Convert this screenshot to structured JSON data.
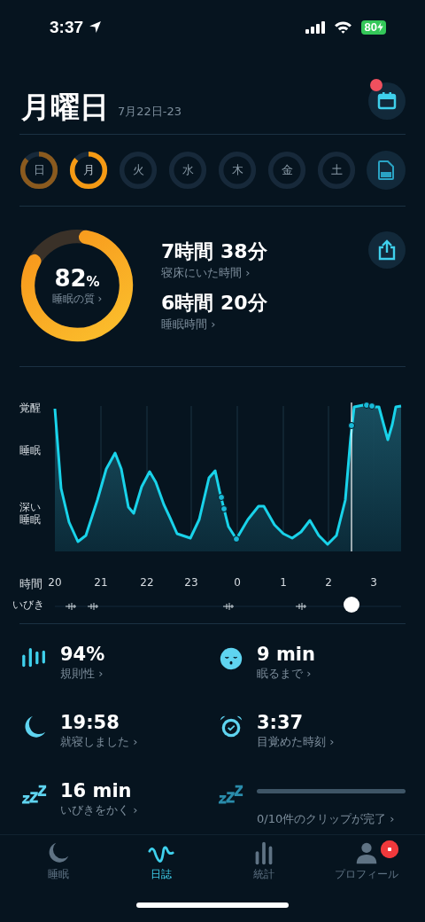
{
  "status_bar": {
    "time": "3:37",
    "battery": "80"
  },
  "header": {
    "title": "月曜日",
    "date_range": "7月22日-23",
    "calendar_badge": true
  },
  "days": [
    {
      "label": "日",
      "selected": false,
      "recorded": true
    },
    {
      "label": "月",
      "selected": true,
      "recorded": true
    },
    {
      "label": "火",
      "selected": false,
      "recorded": false
    },
    {
      "label": "水",
      "selected": false,
      "recorded": false
    },
    {
      "label": "木",
      "selected": false,
      "recorded": false
    },
    {
      "label": "金",
      "selected": false,
      "recorded": false
    },
    {
      "label": "土",
      "selected": false,
      "recorded": false
    }
  ],
  "summary": {
    "quality": {
      "value": "82",
      "unit": "%",
      "label": "睡眠の質 ›"
    },
    "metrics": [
      {
        "value": "7時間 38分",
        "label": "寝床にいた時間 ›"
      },
      {
        "value": "6時間 20分",
        "label": "睡眠時間 ›"
      }
    ]
  },
  "chart": {
    "y_labels": [
      "覚醒",
      "睡眠",
      "深い睡眠"
    ],
    "x_label": "時間",
    "x_ticks": [
      "20",
      "21",
      "22",
      "23",
      "0",
      "1",
      "2",
      "3"
    ],
    "snore_label": "いびき"
  },
  "stats": [
    {
      "kind": "stat",
      "value": "94%",
      "label": "規則性 ›"
    },
    {
      "kind": "stat",
      "value": "9 min",
      "label": "眠るまで ›"
    },
    {
      "kind": "stat",
      "value": "19:58",
      "label": "就寝しました ›"
    },
    {
      "kind": "stat",
      "value": "3:37",
      "label": "目覚めた時刻 ›"
    },
    {
      "kind": "stat",
      "value": "16 min",
      "label": "いびきをかく ›"
    },
    {
      "kind": "progress",
      "level": 0,
      "label": "0/10件のクリップが完了 ›"
    }
  ],
  "tab_bar": [
    {
      "label": "睡眠",
      "selected": false,
      "badge": false
    },
    {
      "label": "日誌",
      "selected": true,
      "badge": false
    },
    {
      "label": "統計",
      "selected": false,
      "badge": false
    },
    {
      "label": "プロフィール",
      "selected": false,
      "badge": true
    }
  ]
}
